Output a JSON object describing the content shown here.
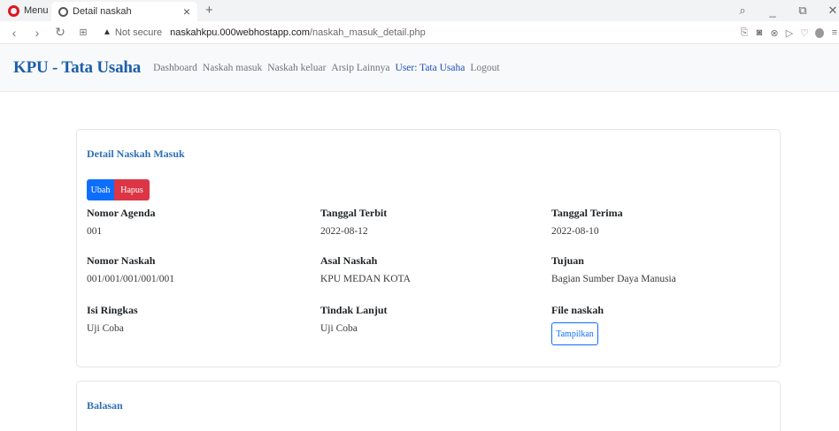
{
  "browser": {
    "menu_label": "Menu",
    "tab_title": "Detail naskah",
    "tab_close": "×",
    "new_tab": "+",
    "security_label": "Not secure",
    "url_domain": "naskahkpu.000webhostapp.com",
    "url_path": "/naskah_masuk_detail.php",
    "icons": [
      "opera-logo-icon",
      "globe-icon",
      "back-icon",
      "forward-icon",
      "reload-icon",
      "speed-dial-icon",
      "warning-icon",
      "search-icon",
      "minimize-icon",
      "restore-icon",
      "close-icon",
      "snapshot-icon",
      "camera-icon",
      "adblock-icon",
      "play-icon",
      "heart-icon",
      "profile-icon",
      "menu-lines-icon"
    ]
  },
  "navbar": {
    "brand": "KPU - Tata Usaha",
    "links": [
      "Dashboard",
      "Naskah masuk",
      "Naskah keluar",
      "Arsip Lainnya",
      "User: Tata Usaha",
      "Logout"
    ]
  },
  "detail": {
    "title": "Detail Naskah Masuk",
    "ubah": "Ubah",
    "hapus": "Hapus",
    "fields": {
      "nomor_agenda": {
        "label": "Nomor Agenda",
        "value": "001"
      },
      "tanggal_terbit": {
        "label": "Tanggal Terbit",
        "value": "2022-08-12"
      },
      "tanggal_terima": {
        "label": "Tanggal Terima",
        "value": "2022-08-10"
      },
      "nomor_naskah": {
        "label": "Nomor Naskah",
        "value": "001/001/001/001/001"
      },
      "asal_naskah": {
        "label": "Asal Naskah",
        "value": "KPU MEDAN KOTA"
      },
      "tujuan": {
        "label": "Tujuan",
        "value": "Bagian Sumber Daya Manusia"
      },
      "isi_ringkas": {
        "label": "Isi Ringkas",
        "value": "Uji Coba"
      },
      "tindak_lanjut": {
        "label": "Tindak Lanjut",
        "value": "Uji Coba"
      },
      "file_naskah": {
        "label": "File naskah",
        "button": "Tampilkan"
      }
    }
  },
  "balasan": {
    "title": "Balasan"
  },
  "colors": {
    "brand": "#1c5ea9",
    "primary": "#0d6efd",
    "danger": "#dc3545",
    "card_title": "#2f6fb5",
    "user_link": "#1c4fbd"
  }
}
